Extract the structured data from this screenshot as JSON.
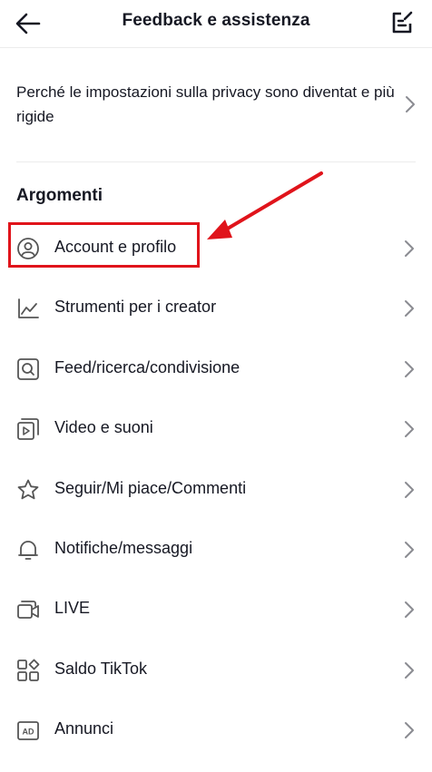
{
  "header": {
    "title": "Feedback e assistenza",
    "back_icon": "arrow-left-icon",
    "edit_icon": "edit-note-icon"
  },
  "featured_question": {
    "text": "Perché le impostazioni sulla privacy sono diventat e più rigide"
  },
  "section": {
    "title": "Argomenti"
  },
  "topics": [
    {
      "label": "Account e profilo",
      "icon": "user-circle-icon"
    },
    {
      "label": "Strumenti per i creator",
      "icon": "chart-line-icon"
    },
    {
      "label": "Feed/ricerca/condivisione",
      "icon": "search-box-icon"
    },
    {
      "label": "Video e suoni",
      "icon": "video-icon"
    },
    {
      "label": "Seguir/Mi piace/Commenti",
      "icon": "star-icon"
    },
    {
      "label": "Notifiche/messaggi",
      "icon": "bell-icon"
    },
    {
      "label": "LIVE",
      "icon": "live-camera-icon"
    },
    {
      "label": "Saldo TikTok",
      "icon": "grid-apps-icon"
    },
    {
      "label": "Annunci",
      "icon": "ad-icon"
    }
  ],
  "annotation": {
    "color": "#e0141b"
  }
}
